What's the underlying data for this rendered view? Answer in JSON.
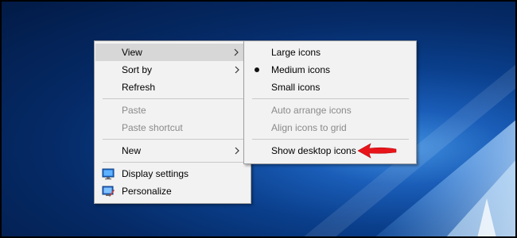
{
  "main_menu": {
    "view_label": "View",
    "sort_by_label": "Sort by",
    "refresh_label": "Refresh",
    "paste_label": "Paste",
    "paste_shortcut_label": "Paste shortcut",
    "new_label": "New",
    "display_settings_label": "Display settings",
    "personalize_label": "Personalize"
  },
  "view_submenu": {
    "large_icons_label": "Large icons",
    "medium_icons_label": "Medium icons",
    "small_icons_label": "Small icons",
    "auto_arrange_label": "Auto arrange icons",
    "align_to_grid_label": "Align icons to grid",
    "show_desktop_icons_label": "Show desktop icons",
    "selected": "Medium icons"
  },
  "icons": {
    "submenu_arrow": "chevron-right-icon",
    "radio_selected": "bullet-icon",
    "display_settings": "monitor-icon",
    "personalize": "personalize-icon",
    "callout": "red-arrow-icon"
  },
  "colors": {
    "menu_bg": "#f2f2f2",
    "hover_bg": "#d7d7d7",
    "disabled_text": "#8a8a8a",
    "callout_arrow": "#e8141a",
    "desktop_blue": "#0a3f8c"
  }
}
